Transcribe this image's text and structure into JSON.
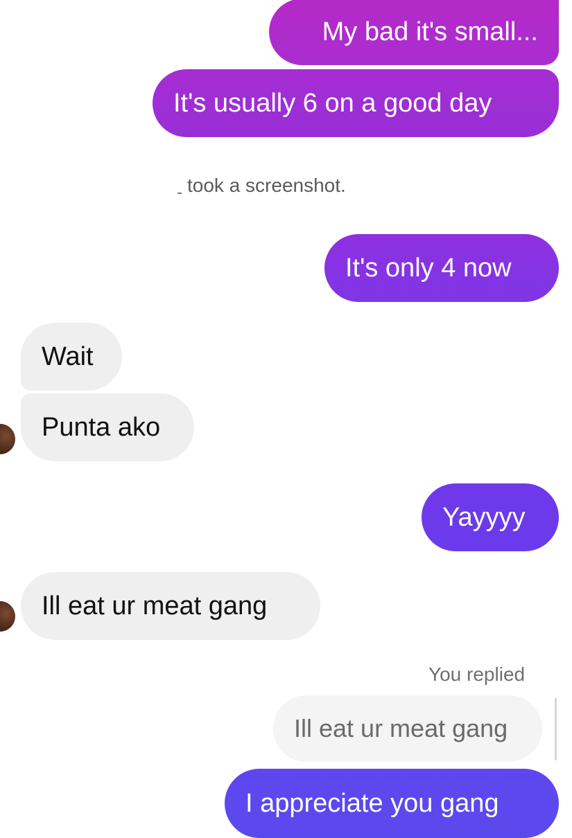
{
  "colors": {
    "outgoing_gradient_top": "#b024c9",
    "outgoing_gradient_mid": "#8e2ee0",
    "outgoing_gradient_bottom": "#5b47ec",
    "incoming_bubble": "#efefef"
  },
  "messages": {
    "m1": "My bad it's small...",
    "m2": "It's usually 6 on a good day",
    "screenshot_notice": "took a screenshot.",
    "m3": "It's only 4 now",
    "m4": "Wait",
    "m5": "Punta ako",
    "m6": "Yayyyy",
    "m7": "Ill eat ur meat gang",
    "reply_label": "You replied",
    "reply_quote": "Ill eat ur meat gang",
    "m8": "I appreciate you gang"
  },
  "icons": {
    "avatar": "contact-avatar"
  }
}
